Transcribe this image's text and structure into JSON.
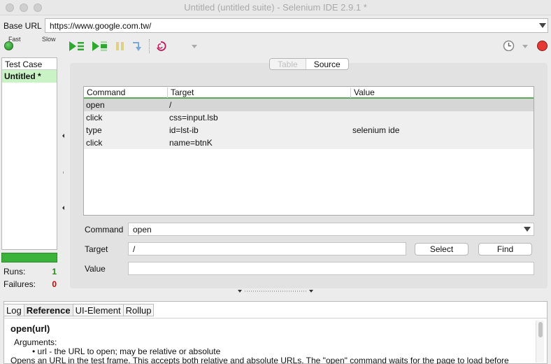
{
  "window": {
    "title": "Untitled (untitled suite) - Selenium IDE 2.9.1 *"
  },
  "base_url": {
    "label": "Base URL",
    "value": "https://www.google.com.tw/"
  },
  "toolbar": {
    "speed_fast": "Fast",
    "speed_slow": "Slow"
  },
  "left_panel": {
    "header": "Test Case",
    "items": [
      {
        "label": "Untitled *"
      }
    ],
    "runs_label": "Runs:",
    "runs_value": "1",
    "failures_label": "Failures:",
    "failures_value": "0",
    "runs_color": "#1a8f1a",
    "failures_color": "#d40000"
  },
  "tabs": {
    "table": "Table",
    "source": "Source"
  },
  "table": {
    "headers": [
      "Command",
      "Target",
      "Value"
    ],
    "rows": [
      {
        "command": "open",
        "target": "/",
        "value": ""
      },
      {
        "command": "click",
        "target": "css=input.lsb",
        "value": ""
      },
      {
        "command": "type",
        "target": "id=lst-ib",
        "value": "selenium ide"
      },
      {
        "command": "click",
        "target": "name=btnK",
        "value": ""
      }
    ]
  },
  "editor": {
    "command_label": "Command",
    "command_value": "open",
    "target_label": "Target",
    "target_value": "/",
    "value_label": "Value",
    "value_value": "",
    "select_button": "Select",
    "find_button": "Find"
  },
  "bottom": {
    "tabs": [
      "Log",
      "Reference",
      "UI-Element",
      "Rollup"
    ],
    "ref_title": "open(url)",
    "ref_args_label": "Arguments:",
    "ref_bullet": "url - the URL to open; may be relative or absolute",
    "ref_desc": "Opens an URL in the test frame. This accepts both relative and absolute URLs. The \"open\" command waits for the page to load before proceeding"
  },
  "colors": {
    "accent_green": "#3bb33b",
    "selected_row": "#d6d6d6",
    "record_red": "#e53935"
  }
}
